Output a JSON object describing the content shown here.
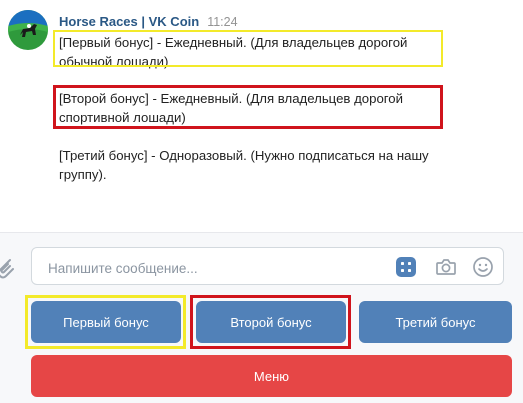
{
  "message": {
    "sender": "Horse Races | VK Coin",
    "time": "11:24",
    "bonuses": [
      {
        "text": "[Первый бонус] - Ежедневный. (Для владельцев дорогой\nобычной лошади)"
      },
      {
        "text": "[Второй бонус] - Ежедневный. (Для владельцев дорогой\nспортивной лошади)"
      },
      {
        "text": "[Третий бонус] - Одноразовый. (Нужно подписаться на нашу\nгруппу)."
      }
    ]
  },
  "compose": {
    "placeholder": "Напишите сообщение..."
  },
  "keyboard": {
    "buttons": [
      {
        "label": "Первый бонус"
      },
      {
        "label": "Второй бонус"
      },
      {
        "label": "Третий бонус"
      }
    ],
    "menu_label": "Меню"
  },
  "colors": {
    "link": "#2a5885",
    "primary_button": "#5181b8",
    "negative_button": "#e64646",
    "highlight_yellow": "#f3ea2a",
    "highlight_red": "#d0141c"
  },
  "icons": {
    "attach": "paperclip-icon",
    "keyboard": "bot-keyboard-icon",
    "camera": "camera-icon",
    "emoji": "smile-icon"
  }
}
